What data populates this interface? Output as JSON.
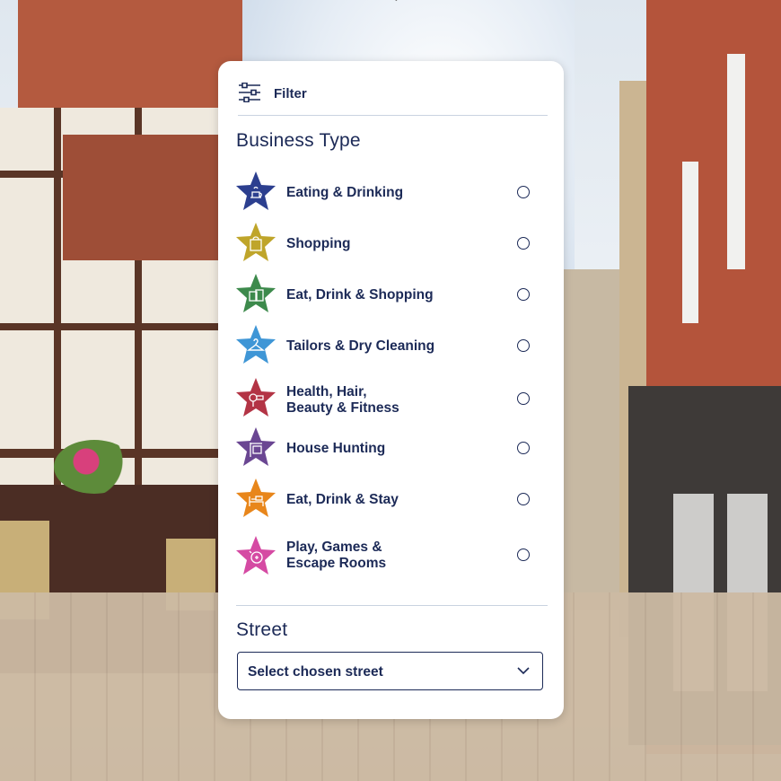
{
  "filter": {
    "label": "Filter",
    "icon": "sliders-icon"
  },
  "business_type": {
    "title": "Business Type",
    "items": [
      {
        "label": "Eating & Drinking",
        "icon": "food-drink-icon",
        "color": "#2c3f8f",
        "selected": false
      },
      {
        "label": "Shopping",
        "icon": "shopping-bag-icon",
        "color": "#bfa52a",
        "selected": false
      },
      {
        "label": "Eat, Drink & Shopping",
        "icon": "food-shopping-icon",
        "color": "#3d8a4c",
        "selected": false
      },
      {
        "label": "Tailors & Dry Cleaning",
        "icon": "hanger-icon",
        "color": "#3f96d6",
        "selected": false
      },
      {
        "label": "Health, Hair,\nBeauty & Fitness",
        "icon": "hairdryer-icon",
        "color": "#b33445",
        "selected": false
      },
      {
        "label": "House Hunting",
        "icon": "house-sign-icon",
        "color": "#6a4692",
        "selected": false
      },
      {
        "label": "Eat, Drink & Stay",
        "icon": "bed-icon",
        "color": "#e8861b",
        "selected": false
      },
      {
        "label": "Play, Games &\nEscape Rooms",
        "icon": "game-icon",
        "color": "#d54aa3",
        "selected": false
      }
    ]
  },
  "street": {
    "title": "Street",
    "select_value": "Select chosen street",
    "icon": "chevron-down-icon"
  }
}
